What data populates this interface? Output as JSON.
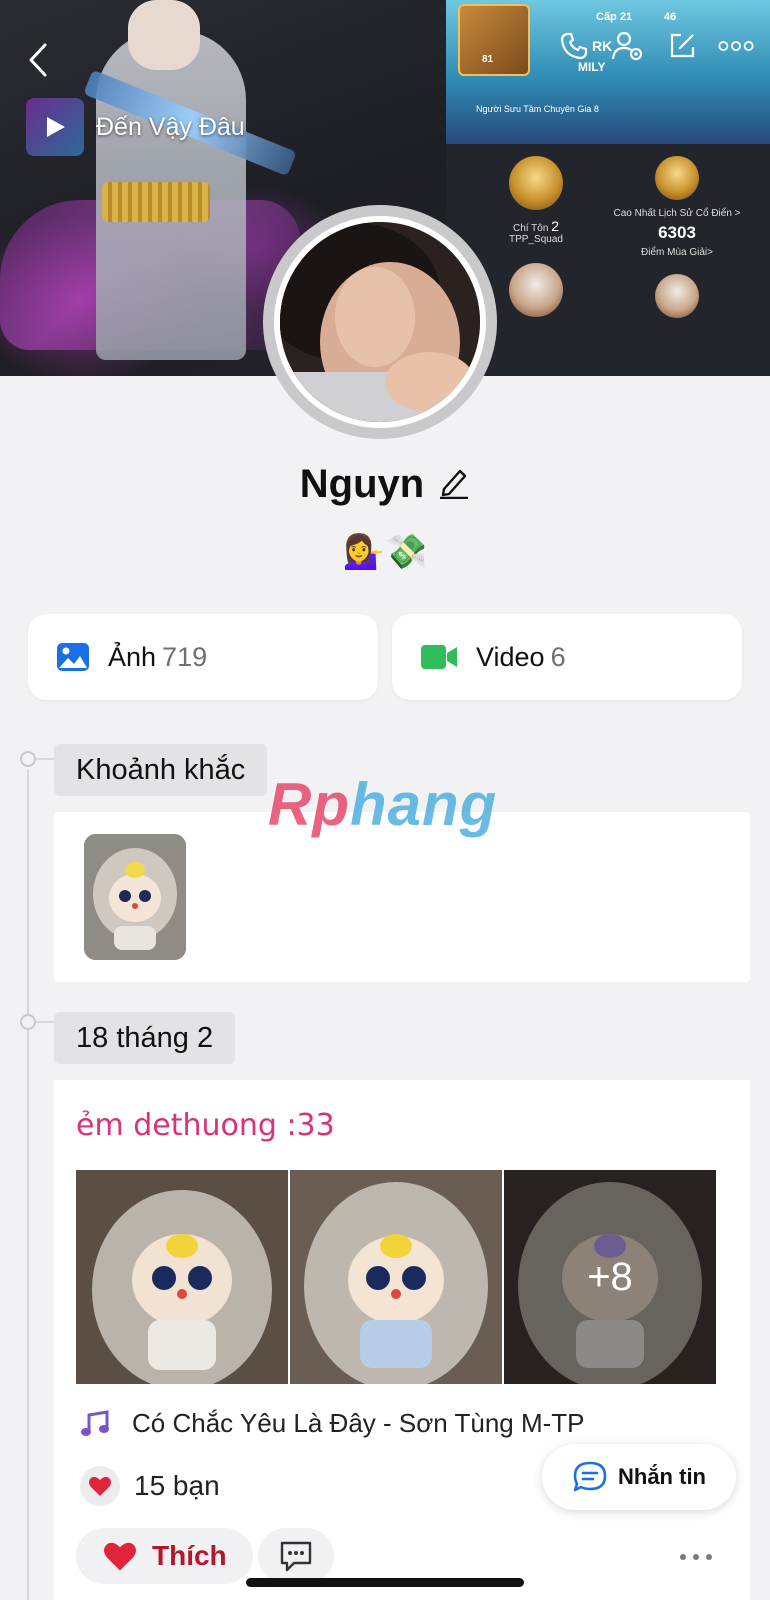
{
  "cover": {
    "music_title": "Đến Vậy Đâu",
    "game": {
      "level": "Cấp 21",
      "badge_count": "46",
      "team": "RK",
      "clan": "MILY",
      "avatar_level": "81",
      "collector_title": "Người Sưu Tầm Chuyên Gia 8",
      "rank_title": "Chí Tôn",
      "rank_value": "2",
      "mode": "TPP_Squad",
      "highest_label": "Cao Nhất Lịch Sử Cổ Điển >",
      "season_points": "6303",
      "season_label": "Điểm Mùa Giải>"
    }
  },
  "profile": {
    "name": "Nguyn",
    "emojis": "💁‍♀️💸"
  },
  "media": {
    "photos_label": "Ảnh",
    "photos_count": "719",
    "videos_label": "Video",
    "videos_count": "6"
  },
  "timeline": {
    "moments_label": "Khoảnh khắc",
    "date_label": "18 tháng 2"
  },
  "post": {
    "caption": "ẻm dethuong :33",
    "extra_photos": "+8",
    "song": "Có Chắc Yêu Là Đây - Sơn Tùng M-TP",
    "reactions": "15 bạn",
    "like_label": "Thích"
  },
  "fab": {
    "message_label": "Nhắn tin"
  },
  "watermark": {
    "part1": "Rp",
    "part2": "hang"
  },
  "colors": {
    "caption": "#d8327a",
    "like": "#b5172a",
    "photo_icon": "#1a6fe8",
    "video_icon": "#2ebd59",
    "message_icon": "#1a6fe8"
  }
}
